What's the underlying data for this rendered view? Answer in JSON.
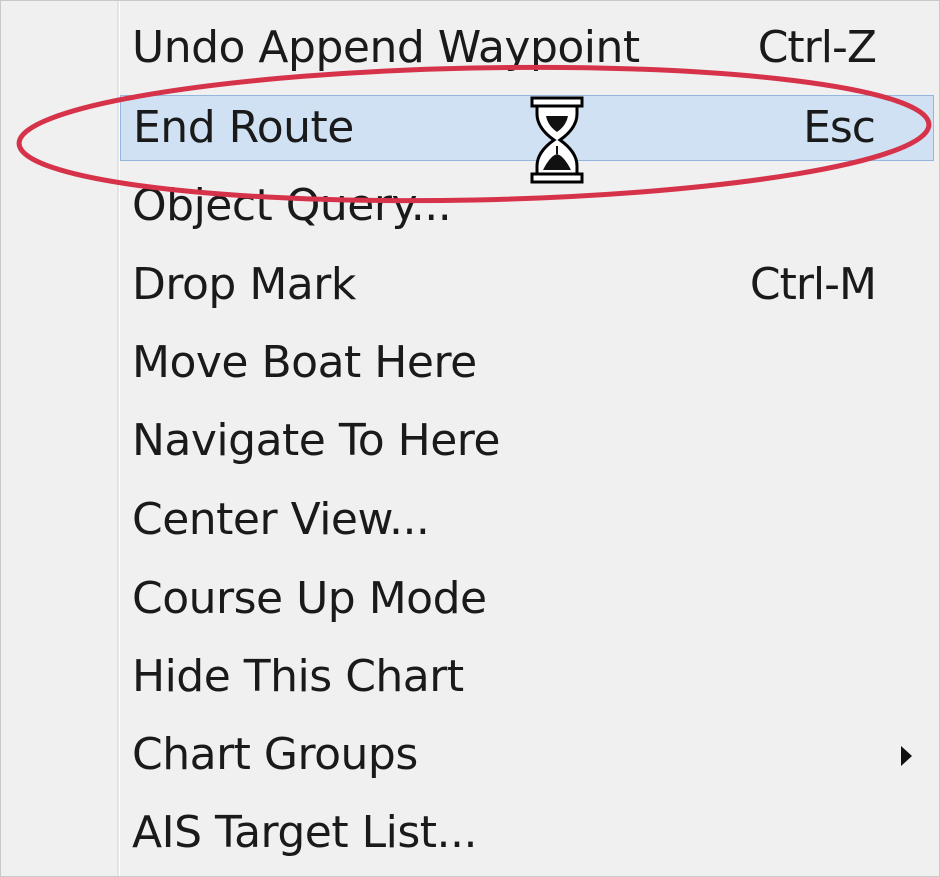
{
  "menu": {
    "items": [
      {
        "label": "Undo Append Waypoint",
        "shortcut": "Ctrl-Z"
      },
      {
        "label": "End Route",
        "shortcut": "Esc"
      },
      {
        "label": "Object Query...",
        "shortcut": ""
      },
      {
        "label": "Drop Mark",
        "shortcut": "Ctrl-M"
      },
      {
        "label": "Move Boat Here",
        "shortcut": ""
      },
      {
        "label": "Navigate To Here",
        "shortcut": ""
      },
      {
        "label": "Center View...",
        "shortcut": ""
      },
      {
        "label": "Course Up Mode",
        "shortcut": ""
      },
      {
        "label": "Hide This Chart",
        "shortcut": ""
      },
      {
        "label": "Chart Groups",
        "shortcut": "",
        "submenu_icon": "submenu-arrow-icon"
      },
      {
        "label": "AIS Target List...",
        "shortcut": ""
      }
    ],
    "highlighted_index": 1,
    "colors": {
      "background": "#f0f0f0",
      "highlight": "#cfe1f3",
      "highlight_border": "#94b7df",
      "annotation": "#d6334b"
    }
  },
  "cursor": {
    "icon": "hourglass-icon"
  },
  "annotation": {
    "icon": "red-ellipse-highlight"
  }
}
